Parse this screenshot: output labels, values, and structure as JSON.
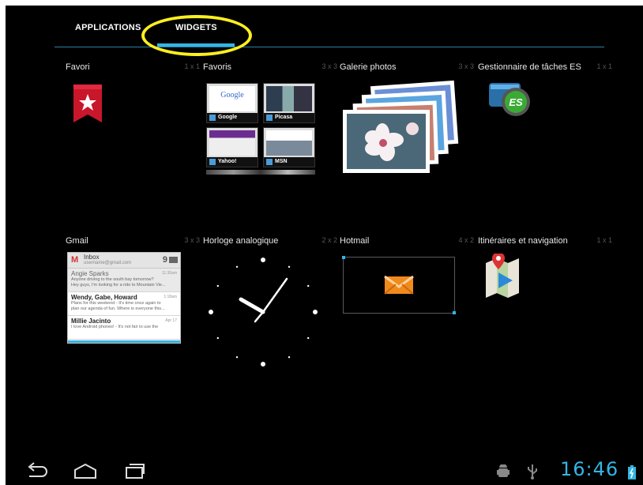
{
  "tabs": {
    "applications": "APPLICATIONS",
    "widgets": "WIDGETS",
    "active": "WIDGETS"
  },
  "widgets": [
    {
      "name": "Favori",
      "size": "1 x 1",
      "icon": "bookmark-icon"
    },
    {
      "name": "Favoris",
      "size": "3 x 3",
      "icon": "bookmarks-grid"
    },
    {
      "name": "Galerie photos",
      "size": "3 x 3",
      "icon": "photo-stack"
    },
    {
      "name": "Gestionnaire de tâches ES",
      "size": "1 x 1",
      "icon": "es-task-manager-icon"
    },
    {
      "name": "Gmail",
      "size": "3 x 3",
      "icon": "gmail-inbox-preview"
    },
    {
      "name": "Horloge analogique",
      "size": "2 x 2",
      "icon": "analog-clock"
    },
    {
      "name": "Hotmail",
      "size": "4 x 2",
      "icon": "hotmail-envelope-icon"
    },
    {
      "name": "Itinéraires et navigation",
      "size": "1 x 1",
      "icon": "maps-navigation-icon"
    }
  ],
  "favoris_thumbs": [
    {
      "label": "Google"
    },
    {
      "label": "Picasa"
    },
    {
      "label": "Yahoo!"
    },
    {
      "label": "MSN"
    }
  ],
  "gmail_preview": {
    "logo": "M",
    "folder": "Inbox",
    "account": "username@gmail.com",
    "unread_count": "9",
    "messages": [
      {
        "sender": "Angie Sparks",
        "date": "11:30am",
        "snippet": "Anyone driving to the south bay tomorrow?",
        "snippet2": "Hey guys, I'm looking for a ride to Mountain Vie...",
        "read": true
      },
      {
        "sender": "Wendy, Gabe, Howard",
        "date": "1:18am",
        "snippet": "Plans for this weekend - It's time once again to",
        "snippet2": "plan our agenda of fun. Where is everyone this...",
        "read": false
      },
      {
        "sender": "Millie Jacinto",
        "date": "Apr 17",
        "snippet": "I love Android phones! - It's not fair to use the",
        "snippet2": "",
        "read": false
      }
    ]
  },
  "status_bar": {
    "time": "16:46",
    "icons": [
      "back-icon",
      "home-icon",
      "recent-apps-icon",
      "android-debug-icon",
      "usb-icon",
      "battery-icon"
    ]
  },
  "colors": {
    "accent": "#33b5e5",
    "background": "#000000",
    "highlight": "#ffef1f"
  }
}
